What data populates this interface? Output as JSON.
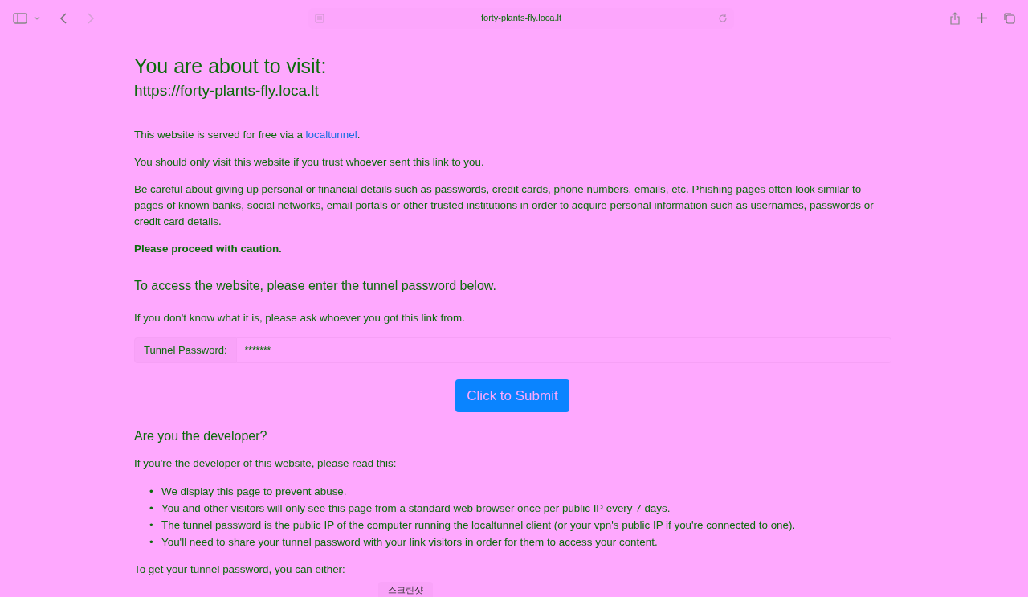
{
  "browser": {
    "address": "forty-plants-fly.loca.lt"
  },
  "heading": "You are about to visit:",
  "url": "https://forty-plants-fly.loca.lt",
  "intro": {
    "before": "This website is served for free via a ",
    "link": "localtunnel",
    "after": "."
  },
  "paragraphs": [
    "You should only visit this website if you trust whoever sent this link to you.",
    "Be careful about giving up personal or financial details such as passwords, credit cards, phone numbers, emails, etc. Phishing pages often look similar to pages of known banks, social networks, email portals or other trusted institutions in order to acquire personal information such as usernames, passwords or credit card details."
  ],
  "caution": "Please proceed with caution.",
  "access_heading": "To access the website, please enter the tunnel password below.",
  "access_hint": "If you don't know what it is, please ask whoever you got this link from.",
  "password": {
    "label": "Tunnel Password:",
    "value": "*******"
  },
  "submit": "Click to Submit",
  "developer_heading": "Are you the developer?",
  "developer_intro": "If you're the developer of this website, please read this:",
  "bullets": [
    {
      "marker": "•",
      "text": "We display this page to prevent abuse."
    },
    {
      "marker": "•",
      "text": "You and other visitors will only see this page from a standard web browser once per public IP every 7 days."
    },
    {
      "marker": "•",
      "text": "The tunnel password is the public IP of the computer running the localtunnel client (or your vpn's public IP if you're connected to one)."
    },
    {
      "marker": "•",
      "text": "You'll need to share your tunnel password with your link visitors in order for them to access your content."
    }
  ],
  "outro": "To get your tunnel password, you can either:",
  "tooltip": "스크린샷"
}
